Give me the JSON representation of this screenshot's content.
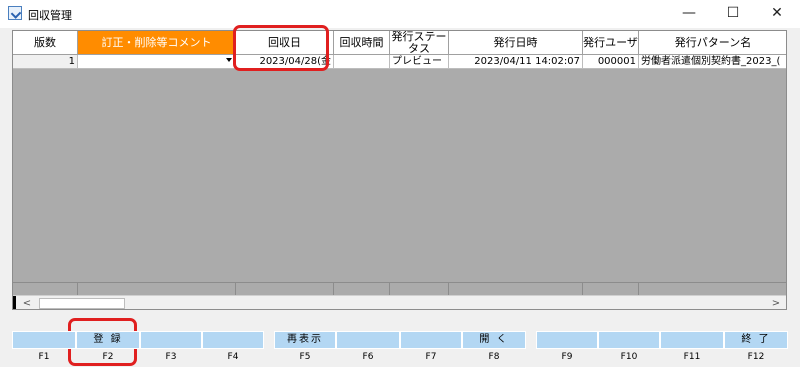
{
  "window": {
    "title": "回収管理",
    "minimize": "—",
    "maximize": "☐",
    "close": "✕"
  },
  "grid": {
    "headers": {
      "version": "版数",
      "comment": "訂正・削除等コメント",
      "collect_date": "回収日",
      "collect_time": "回収時間",
      "status": "発行ステータス",
      "issue_datetime": "発行日時",
      "issue_user": "発行ユーザ",
      "pattern_name": "発行パターン名"
    },
    "rows": [
      {
        "version": "1",
        "comment": "",
        "collect_date": "2023/04/28(金",
        "collect_time": "",
        "status": "プレビュー",
        "issue_datetime": "2023/04/11 14:02:07",
        "issue_user": "000001",
        "pattern_name": "労働者派遣個別契約書_2023_("
      }
    ]
  },
  "fkeys": [
    {
      "key": "F1",
      "label": ""
    },
    {
      "key": "F2",
      "label": "登 録"
    },
    {
      "key": "F3",
      "label": ""
    },
    {
      "key": "F4",
      "label": ""
    },
    {
      "key": "F5",
      "label": "再表示"
    },
    {
      "key": "F6",
      "label": ""
    },
    {
      "key": "F7",
      "label": ""
    },
    {
      "key": "F8",
      "label": "開 く"
    },
    {
      "key": "F9",
      "label": ""
    },
    {
      "key": "F10",
      "label": ""
    },
    {
      "key": "F11",
      "label": ""
    },
    {
      "key": "F12",
      "label": "終 了"
    }
  ],
  "colors": {
    "accent": "#ff8c00",
    "fkey": "#b3d7f3",
    "highlight": "#e01f1f"
  }
}
